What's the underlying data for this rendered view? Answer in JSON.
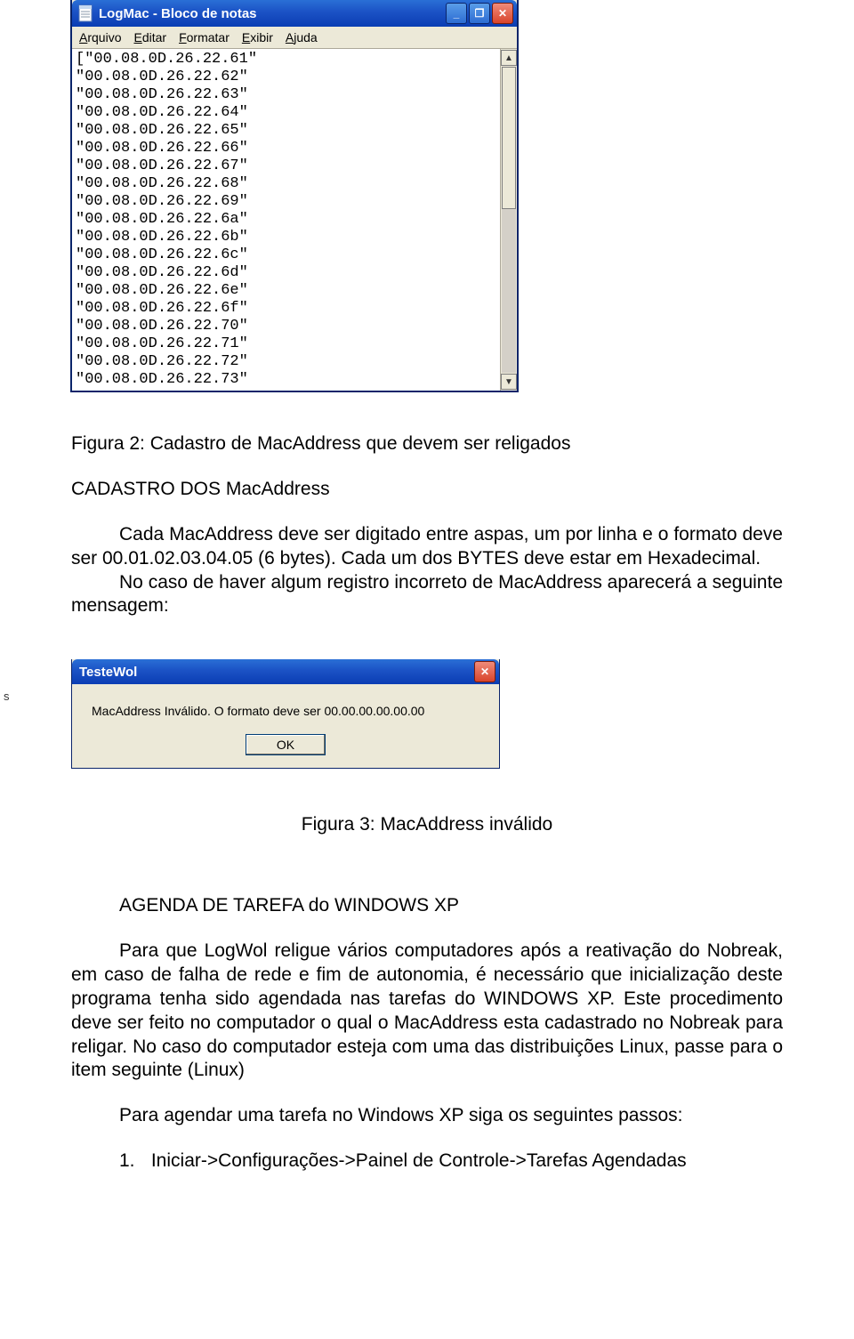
{
  "notepad": {
    "title": "LogMac - Bloco de notas",
    "menus": [
      "Arquivo",
      "Editar",
      "Formatar",
      "Exibir",
      "Ajuda"
    ],
    "lines": [
      "[\"00.08.0D.26.22.61\"",
      "\"00.08.0D.26.22.62\"",
      "\"00.08.0D.26.22.63\"",
      "\"00.08.0D.26.22.64\"",
      "\"00.08.0D.26.22.65\"",
      "\"00.08.0D.26.22.66\"",
      "\"00.08.0D.26.22.67\"",
      "\"00.08.0D.26.22.68\"",
      "\"00.08.0D.26.22.69\"",
      "\"00.08.0D.26.22.6a\"",
      "\"00.08.0D.26.22.6b\"",
      "\"00.08.0D.26.22.6c\"",
      "\"00.08.0D.26.22.6d\"",
      "\"00.08.0D.26.22.6e\"",
      "\"00.08.0D.26.22.6f\"",
      "\"00.08.0D.26.22.70\"",
      "\"00.08.0D.26.22.71\"",
      "\"00.08.0D.26.22.72\"",
      "\"00.08.0D.26.22.73\""
    ],
    "win_btn_tips": {
      "min": "_",
      "max": "❐",
      "close": "✕"
    },
    "scroll": {
      "up": "▲",
      "down": "▼"
    }
  },
  "fig2_caption": "Figura 2: Cadastro de MacAddress que devem ser religados",
  "section1_title": "CADASTRO DOS MacAddress",
  "para1a": "Cada MacAddress deve ser digitado entre aspas, um por linha e o formato deve ser 00.01.02.03.04.05 (6 bytes). Cada um dos BYTES deve estar em Hexadecimal.",
  "para1b": "No caso de haver algum registro incorreto de MacAddress aparecerá a seguinte mensagem:",
  "dialog": {
    "title": "TesteWol",
    "message": "MacAddress Inválido. O formato deve ser 00.00.00.00.00.00",
    "ok": "OK"
  },
  "artifact_left": "s",
  "fig3_caption": "Figura 3: MacAddress inválido",
  "section2_title": "AGENDA DE TAREFA do WINDOWS XP",
  "para2": "Para que LogWol religue vários computadores após a reativação do Nobreak, em caso de falha de rede e fim de autonomia, é necessário que inicialização deste programa tenha sido agendada nas tarefas do WINDOWS XP. Este procedimento deve ser feito no computador o qual o MacAddress esta cadastrado no Nobreak para religar. No caso do computador esteja com uma das distribuições Linux, passe para o item seguinte (Linux)",
  "para3": "Para agendar uma tarefa no Windows XP siga os seguintes passos:",
  "step1_num": "1.",
  "step1_text": "Iniciar->Configurações->Painel de Controle->Tarefas Agendadas"
}
